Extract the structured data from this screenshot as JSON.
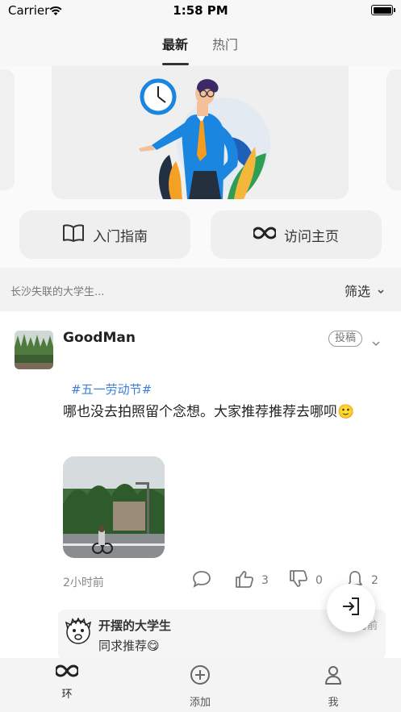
{
  "status_bar": {
    "carrier": "Carrier",
    "time": "1:58 PM"
  },
  "tabs": [
    {
      "label": "最新",
      "active": true
    },
    {
      "label": "热门",
      "active": false
    }
  ],
  "actions": {
    "guide_label": "入门指南",
    "visit_label": "访问主页"
  },
  "filter": {
    "hint": "长沙失联的大学生...",
    "button_label": "筛选"
  },
  "post": {
    "username": "GoodMan",
    "badge": "投稿",
    "hashtag": "#五一劳动节#",
    "text": " 哪也没去拍照留个念想。大家推荐推荐去哪呗🙂",
    "time": "2小时前",
    "likes": "3",
    "dislikes": "0",
    "notifications": "2"
  },
  "comment": {
    "name": "开摆的大学生",
    "text": "同求推荐😋",
    "time": "2小时前"
  },
  "bottom_nav": {
    "ring": "环",
    "add": "添加",
    "me": "我"
  },
  "colors": {
    "accent_blue": "#3d7fd8",
    "fab_bg": "#ffffff"
  },
  "icons": [
    "wifi-icon",
    "battery-icon",
    "book-icon",
    "infinity-icon",
    "chevron-down-icon",
    "comment-icon",
    "thumbs-up-icon",
    "thumbs-down-icon",
    "bell-icon",
    "login-icon",
    "plus-circle-icon",
    "user-icon"
  ]
}
